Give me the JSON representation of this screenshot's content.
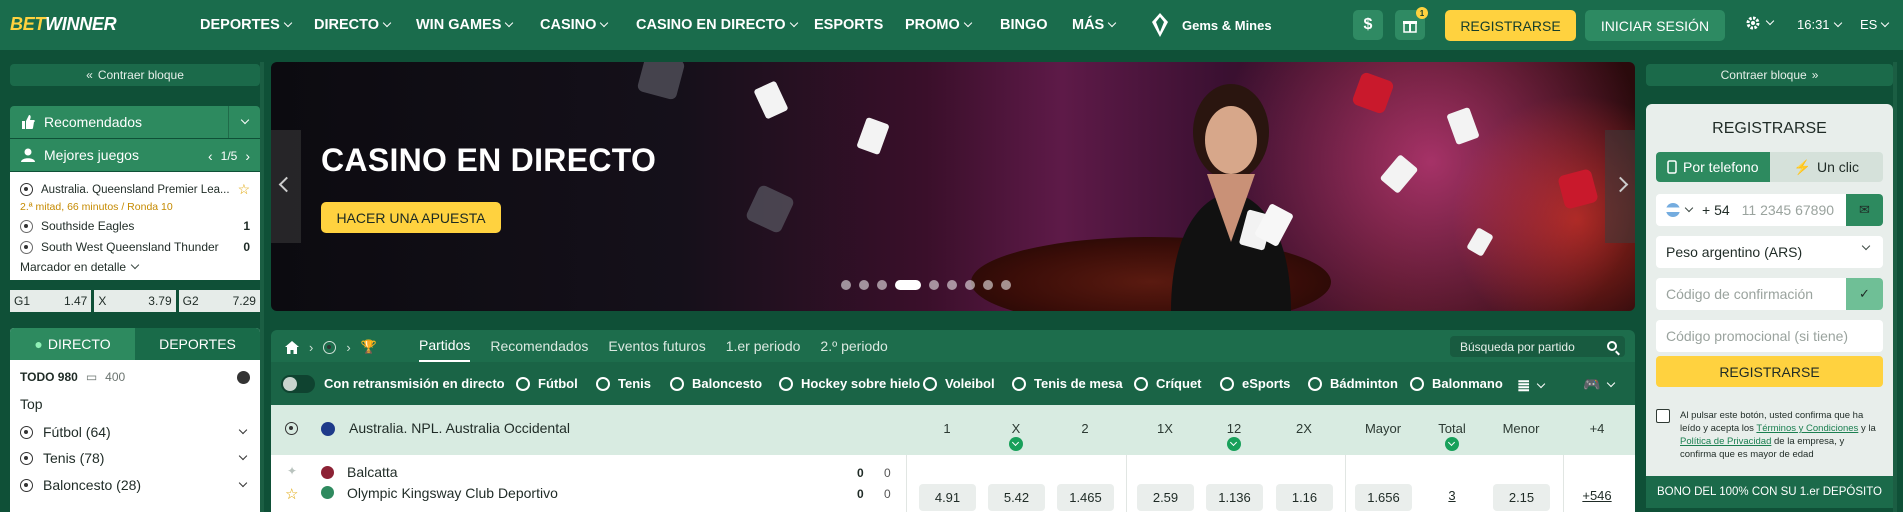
{
  "brand": {
    "logo_part1": "BET",
    "logo_part2": "WINNER"
  },
  "nav": {
    "items": [
      "DEPORTES",
      "DIRECTO",
      "WIN GAMES",
      "CASINO",
      "CASINO EN DIRECTO",
      "ESPORTS",
      "PROMO",
      "BINGO",
      "MÁS"
    ],
    "gems": "Gems & Mines",
    "dollar": "$",
    "gift_badge": "1",
    "register": "REGISTRARSE",
    "login": "INICIAR SESIÓN",
    "time": "16:31",
    "lang": "ES"
  },
  "left": {
    "collapse": "Contraer bloque",
    "recommended": "Recomendados",
    "best_games": "Mejores juegos",
    "pager": "1/5",
    "match": {
      "league": "Australia. Queensland Premier Lea...",
      "status": "2.ª mitad, 66 minutos / Ronda 10",
      "team1": "Southside Eagles",
      "score1": "1",
      "team2": "South West Queensland Thunder",
      "score2": "0",
      "details": "Marcador en detalle"
    },
    "odds": [
      {
        "label": "G1",
        "value": "1.47"
      },
      {
        "label": "X",
        "value": "3.79"
      },
      {
        "label": "G2",
        "value": "7.29"
      }
    ],
    "live_tab": "DIRECTO",
    "sports_tab": "DEPORTES",
    "todo": "TODO 980",
    "todo_count": "400",
    "top": "Top",
    "sports": [
      "Fútbol (64)",
      "Tenis (78)",
      "Baloncesto (28)"
    ]
  },
  "banner": {
    "title": "CASINO EN DIRECTO",
    "button": "HACER UNA APUESTA",
    "dots_total": 10,
    "dot_active": 4
  },
  "panel": {
    "tabs": [
      "Partidos",
      "Recomendados",
      "Eventos futuros",
      "1.er periodo",
      "2.º periodo"
    ],
    "search": "Búsqueda por partido",
    "live_toggle": "Con retransmisión en directo",
    "sports": [
      "Fútbol",
      "Tenis",
      "Baloncesto",
      "Hockey sobre hielo",
      "Voleibol",
      "Tenis de mesa",
      "Críquet",
      "eSports",
      "Bádminton",
      "Balonmano"
    ]
  },
  "league": {
    "name": "Australia. NPL. Australia Occidental",
    "columns": [
      "1",
      "X",
      "2",
      "1X",
      "12",
      "2X",
      "Mayor",
      "Total",
      "Menor",
      "+4"
    ]
  },
  "event": {
    "team1": "Balcatta",
    "team2": "Olympic Kingsway Club Deportivo",
    "score1a": "0",
    "score1b": "0",
    "score2a": "0",
    "score2b": "0",
    "odds": [
      "4.91",
      "5.42",
      "1.465",
      "2.59",
      "1.136",
      "1.16",
      "1.656",
      "3",
      "2.15",
      "+546"
    ]
  },
  "right": {
    "collapse": "Contraer bloque",
    "title": "REGISTRARSE",
    "tab_phone": "Por telefono",
    "tab_click": "Un clic",
    "prefix": "+ 54",
    "phone_placeholder": "11 2345 67890",
    "currency": "Peso argentino (ARS)",
    "code_placeholder": "Código de confirmación",
    "promo_placeholder": "Código promocional (si tiene)",
    "submit": "REGISTRARSE",
    "terms_1": "Al pulsar este botón, usted confirma que ha leído y acepta los ",
    "terms_link1": "Términos y Condiciones",
    "terms_2": " y la ",
    "terms_link2": "Política de Privacidad",
    "terms_3": " de la empresa, y confirma que es mayor de edad",
    "bonus": "BONO DEL 100% CON SU 1.er DEPÓSITO"
  }
}
